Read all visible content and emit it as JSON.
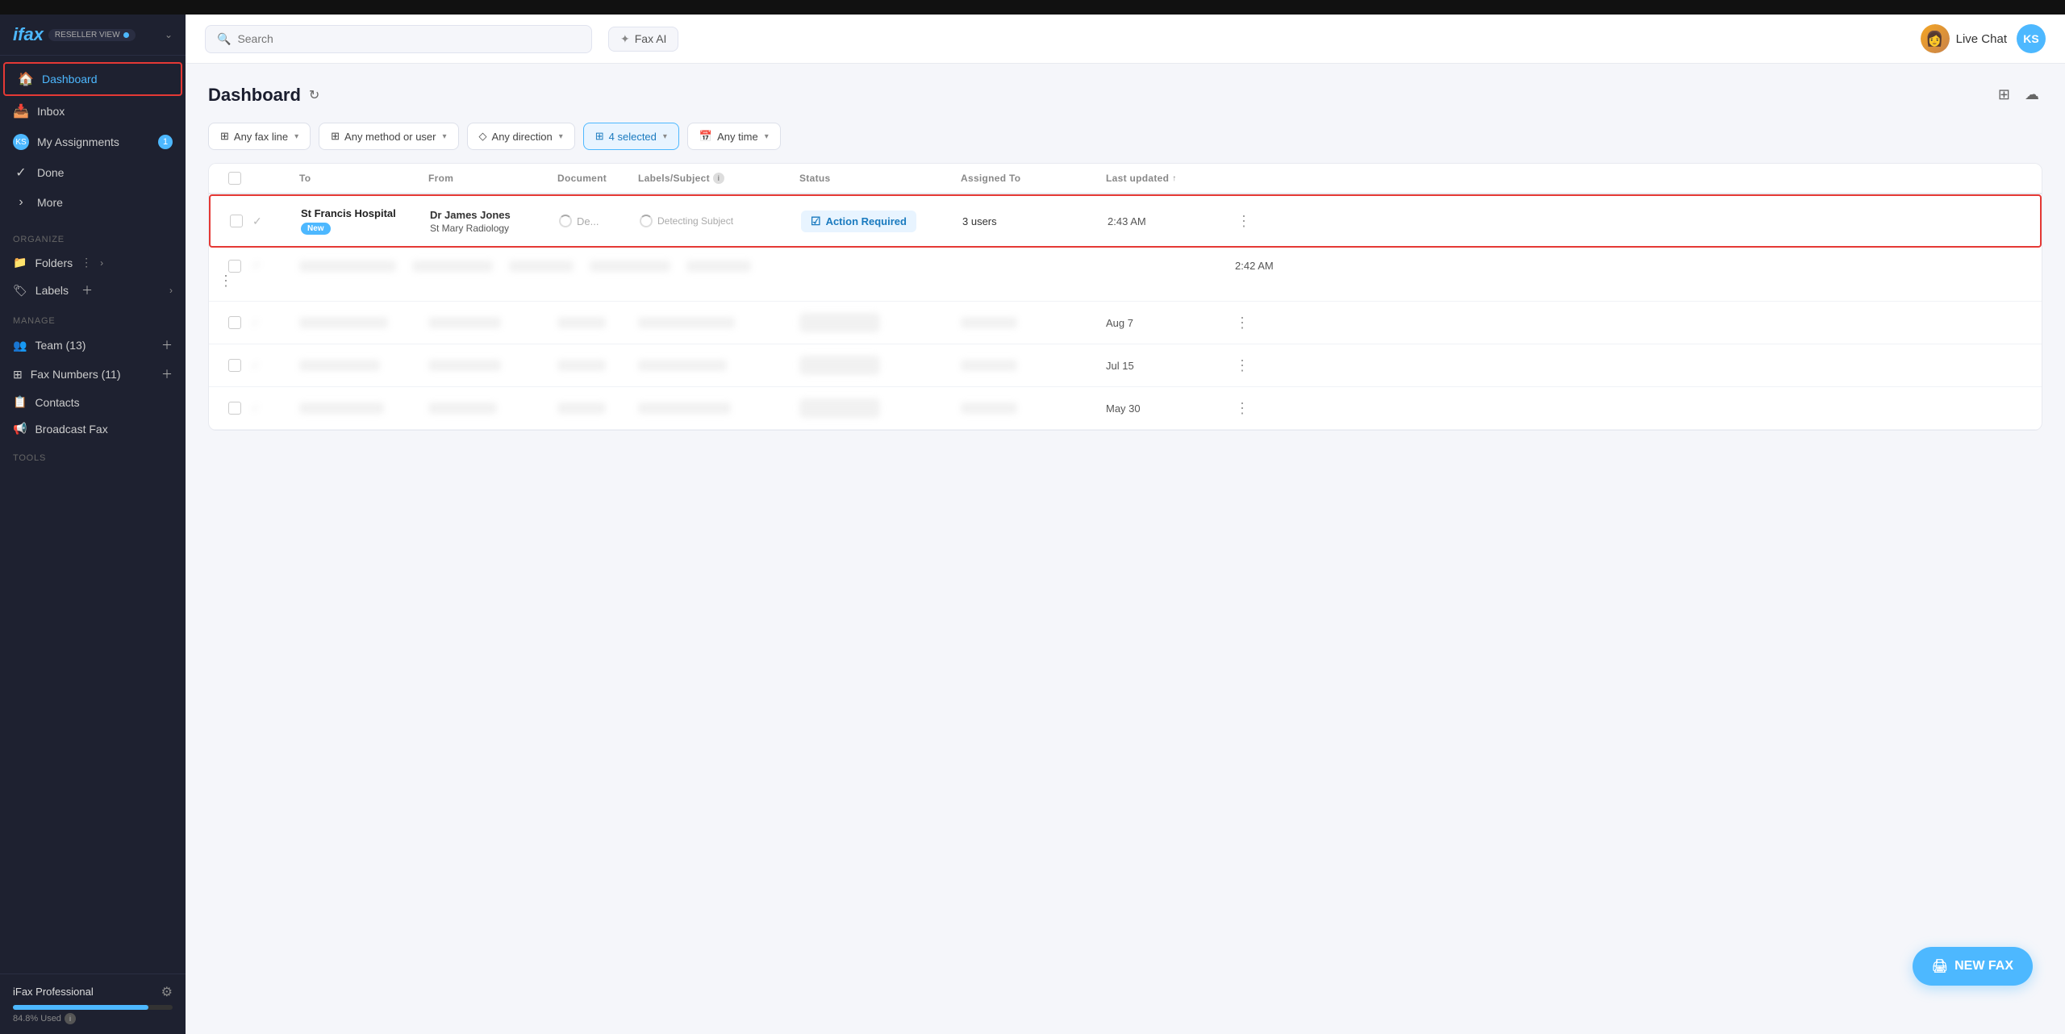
{
  "topbar": {
    "search_placeholder": "Search",
    "fax_ai_label": "Fax AI",
    "live_chat_label": "Live Chat",
    "user_initials": "KS"
  },
  "sidebar": {
    "logo": "ifax",
    "reseller_label": "RESELLER VIEW",
    "nav_items": [
      {
        "id": "dashboard",
        "label": "Dashboard",
        "icon": "🏠",
        "active": true
      },
      {
        "id": "inbox",
        "label": "Inbox",
        "icon": "📥",
        "badge": null
      },
      {
        "id": "my-assignments",
        "label": "My Assignments",
        "icon": "KS",
        "badge": "1"
      },
      {
        "id": "done",
        "label": "Done",
        "icon": "✓",
        "badge": null
      },
      {
        "id": "more",
        "label": "More",
        "icon": "›",
        "badge": null
      }
    ],
    "organize_title": "ORGANIZE",
    "folders_label": "Folders",
    "labels_label": "Labels",
    "manage_title": "MANAGE",
    "team_label": "Team (13)",
    "fax_numbers_label": "Fax Numbers (11)",
    "contacts_label": "Contacts",
    "broadcast_label": "Broadcast Fax",
    "tools_title": "TOOLS",
    "plan_label": "iFax Professional",
    "storage_used": "84.8% Used"
  },
  "page": {
    "title": "Dashboard",
    "view_icon": "⊞",
    "cloud_icon": "☁"
  },
  "filters": [
    {
      "id": "fax-line",
      "icon": "⊞",
      "label": "Any fax line",
      "highlighted": false
    },
    {
      "id": "method-user",
      "icon": "⊞",
      "label": "Any method or user",
      "highlighted": false
    },
    {
      "id": "direction",
      "icon": "◇",
      "label": "Any direction",
      "highlighted": false
    },
    {
      "id": "selected",
      "icon": "⊞",
      "label": "4 selected",
      "highlighted": true
    },
    {
      "id": "time",
      "icon": "📅",
      "label": "Any time",
      "highlighted": false
    }
  ],
  "table": {
    "columns": [
      "",
      "",
      "To",
      "From",
      "Document",
      "Labels/Subject",
      "Status",
      "Assigned To",
      "Last updated",
      ""
    ],
    "rows": [
      {
        "id": 1,
        "highlighted": true,
        "to": "St Francis Hospital",
        "to_badge": "New",
        "from": "Dr James Jones",
        "from_sub": "St Mary Radiology",
        "document": "De...",
        "detecting": "Detecting Subject",
        "status": "Action Required",
        "assigned": "3 users",
        "updated": "2:43 AM",
        "blurred": false
      },
      {
        "id": 2,
        "highlighted": false,
        "to": "",
        "to_badge": "",
        "from": "",
        "from_sub": "",
        "document": "",
        "detecting": "",
        "status": "",
        "assigned": "",
        "updated": "2:42 AM",
        "blurred": true
      },
      {
        "id": 3,
        "highlighted": false,
        "to": "",
        "to_badge": "",
        "from": "",
        "from_sub": "",
        "document": "",
        "detecting": "",
        "status": "",
        "assigned": "",
        "updated": "Aug 7",
        "blurred": true
      },
      {
        "id": 4,
        "highlighted": false,
        "to": "",
        "to_badge": "",
        "from": "",
        "from_sub": "",
        "document": "",
        "detecting": "",
        "status": "",
        "assigned": "",
        "updated": "Jul 15",
        "blurred": true
      },
      {
        "id": 5,
        "highlighted": false,
        "to": "",
        "to_badge": "",
        "from": "",
        "from_sub": "",
        "document": "",
        "detecting": "",
        "status": "",
        "assigned": "",
        "updated": "May 30",
        "blurred": true
      }
    ]
  },
  "new_fax_label": "NEW FAX"
}
